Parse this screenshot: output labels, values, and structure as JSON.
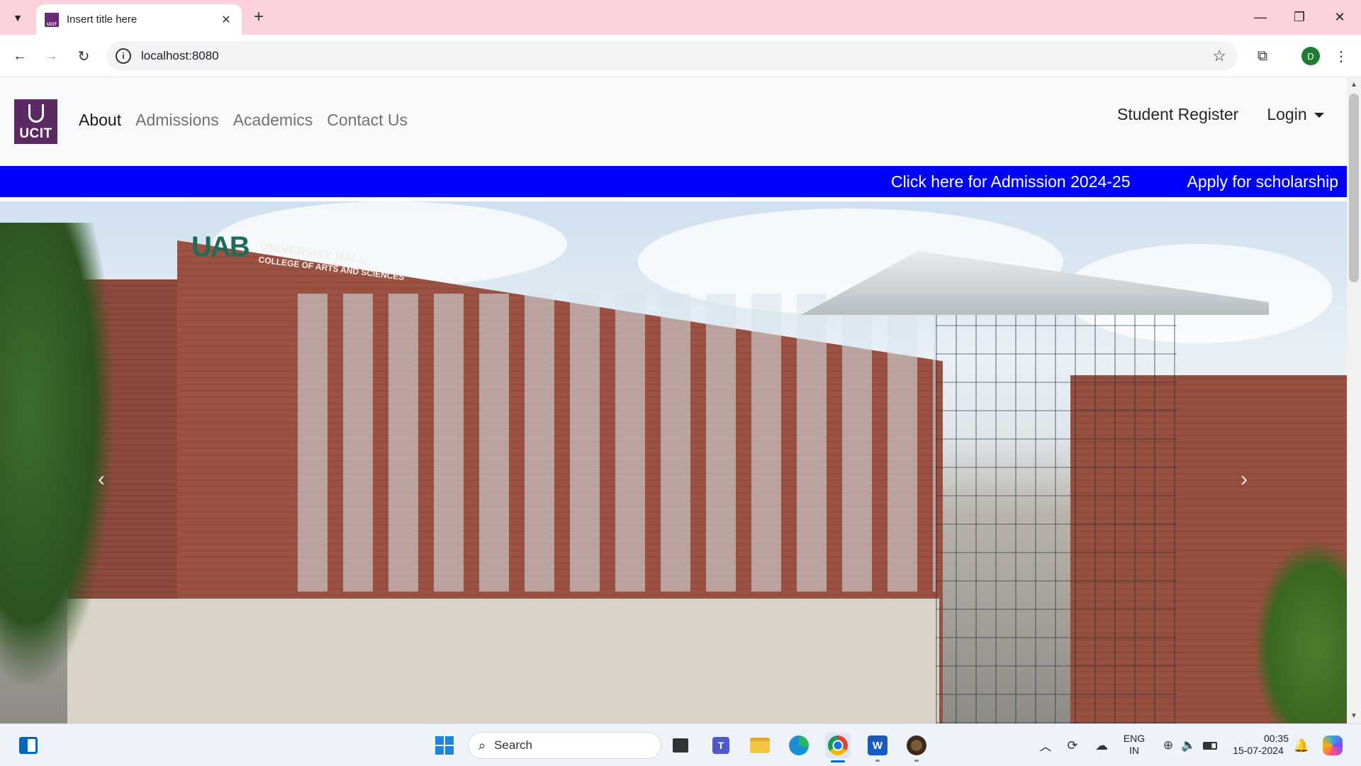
{
  "browser": {
    "tab_title": "Insert title here",
    "tab_close": "✕",
    "new_tab": "+",
    "url": "localhost:8080",
    "profile_initial": "D",
    "icons": {
      "tab_search": "chevron-down-icon",
      "back": "arrow-left-icon",
      "forward": "arrow-right-icon",
      "reload": "reload-icon",
      "site_info": "info-icon",
      "bookmark": "star-icon",
      "extensions": "puzzle-icon",
      "menu": "more-vertical-icon"
    },
    "window_controls": [
      "minimize",
      "restore",
      "close"
    ]
  },
  "site": {
    "logo_text": "UCIT",
    "nav": [
      "About",
      "Admissions",
      "Academics",
      "Contact Us"
    ],
    "active_nav": "About",
    "student_register": "Student Register",
    "login": "Login",
    "promo": {
      "admission": "Click here for Admission 2024-25",
      "scholarship": "Apply for scholarship",
      "background": "#0000ff"
    },
    "carousel": {
      "image_sign_logo": "UAB",
      "image_sign_line1": "UNIVERSITY HALL",
      "image_sign_line2": "COLLEGE OF ARTS AND SCIENCES",
      "prev": "‹",
      "next": "›"
    }
  },
  "taskbar": {
    "search_label": "Search",
    "language_line1": "ENG",
    "language_line2": "IN",
    "time": "00:35",
    "date": "15-07-2024",
    "apps": [
      "start",
      "search",
      "task-view",
      "teams",
      "file-explorer",
      "edge",
      "chrome",
      "word",
      "app"
    ],
    "colors": {
      "accent": "#0067c0",
      "brand_purple": "#5b2a63"
    }
  }
}
